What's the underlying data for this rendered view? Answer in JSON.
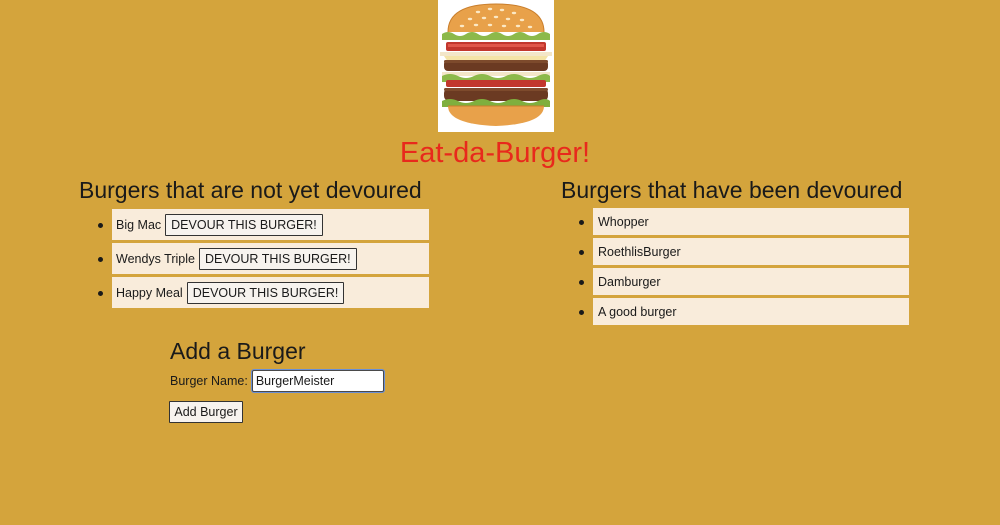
{
  "colors": {
    "page_background": "#d4a43c",
    "title": "#e8291c",
    "list_item_background": "#f9ecdb"
  },
  "logo": {
    "icon": "burger-icon"
  },
  "app": {
    "title": "Eat-da-Burger!"
  },
  "not_devoured": {
    "heading": "Burgers that are not yet devoured",
    "button_label": "DEVOUR THIS BURGER!",
    "items": [
      {
        "name": "Big Mac"
      },
      {
        "name": "Wendys Triple"
      },
      {
        "name": "Happy Meal"
      }
    ]
  },
  "devoured": {
    "heading": "Burgers that have been devoured",
    "items": [
      {
        "name": "Whopper"
      },
      {
        "name": "RoethlisBurger"
      },
      {
        "name": "Damburger"
      },
      {
        "name": "A good burger"
      }
    ]
  },
  "add_form": {
    "heading": "Add a Burger",
    "name_label": "Burger Name:",
    "name_value": "BurgerMeister",
    "submit_label": "Add Burger"
  }
}
